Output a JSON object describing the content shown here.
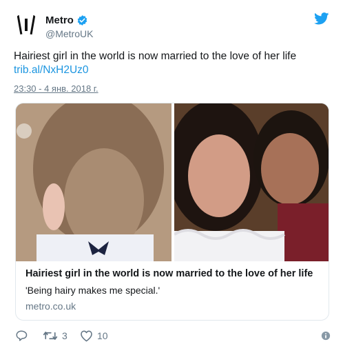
{
  "author": {
    "display_name": "Metro",
    "handle": "@MetroUK"
  },
  "tweet": {
    "text": "Hairiest girl in the world is now married to the love of her life",
    "link": "trib.al/NxH2Uz0",
    "timestamp": "23:30 - 4 янв. 2018 г."
  },
  "card": {
    "title": "Hairiest girl in the world is now married to the love of her life",
    "description": "'Being hairy makes me special.'",
    "domain": "metro.co.uk"
  },
  "actions": {
    "retweet_count": "3",
    "like_count": "10"
  },
  "icons": {
    "verified": "verified-badge-icon",
    "twitter": "twitter-bird-icon",
    "reply": "reply-icon",
    "retweet": "retweet-icon",
    "like": "heart-icon",
    "info": "info-icon"
  },
  "colors": {
    "accent": "#1da1f2",
    "link": "#1b95e0",
    "muted": "#657786",
    "text": "#14171a",
    "border": "#e1e8ed"
  }
}
